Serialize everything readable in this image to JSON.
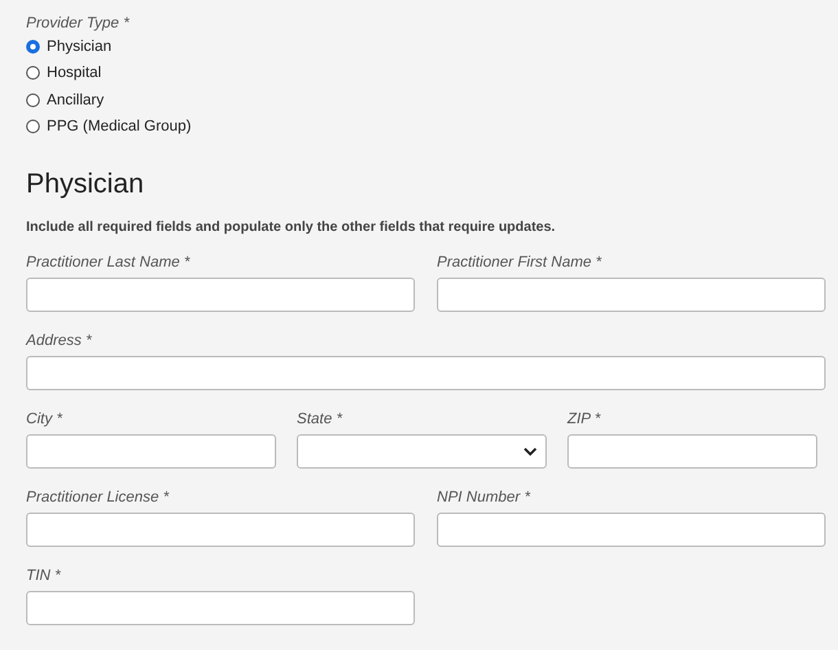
{
  "provider_type": {
    "label": "Provider Type *",
    "options": [
      {
        "label": "Physician",
        "selected": true
      },
      {
        "label": "Hospital",
        "selected": false
      },
      {
        "label": "Ancillary",
        "selected": false
      },
      {
        "label": "PPG (Medical Group)",
        "selected": false
      }
    ]
  },
  "section_title": "Physician",
  "instructions": "Include all required fields and populate only the other fields that require updates.",
  "rows": [
    {
      "kind": "pair",
      "fields": [
        {
          "label": "Practitioner Last Name *",
          "kind": "text"
        },
        {
          "label": "Practitioner First Name *",
          "kind": "text"
        }
      ]
    },
    {
      "kind": "full",
      "fields": [
        {
          "label": "Address *",
          "kind": "text"
        }
      ]
    },
    {
      "kind": "triple",
      "fields": [
        {
          "label": "City *",
          "kind": "text"
        },
        {
          "label": "State *",
          "kind": "select"
        },
        {
          "label": "ZIP *",
          "kind": "text"
        }
      ]
    },
    {
      "kind": "pair",
      "fields": [
        {
          "label": "Practitioner License *",
          "kind": "text"
        },
        {
          "label": "NPI Number *",
          "kind": "text"
        }
      ]
    },
    {
      "kind": "pair",
      "fields": [
        {
          "label": "TIN *",
          "kind": "text"
        }
      ]
    }
  ]
}
